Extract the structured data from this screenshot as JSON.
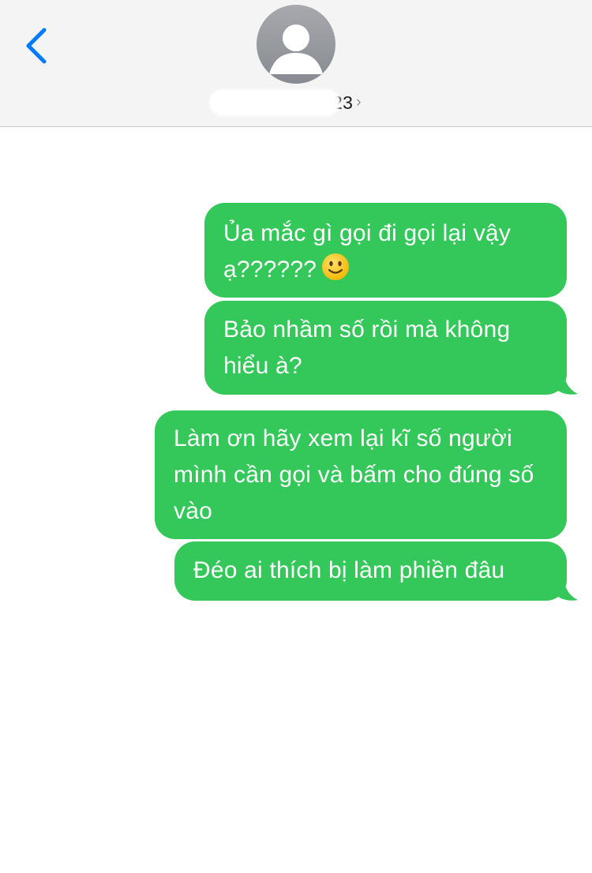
{
  "header": {
    "back_icon": "chevron-left-icon",
    "avatar_icon": "person-silhouette-icon",
    "contact_name": "23",
    "chevron": "›",
    "accent_color": "#007aff"
  },
  "messages": [
    {
      "text": "Ủa mắc gì gọi đi gọi lại vậy ạ??????",
      "emoji": "slightly-smiling-face"
    },
    {
      "text": "Bảo nhầm số rồi mà không hiểu à?"
    },
    {
      "text": "Làm ơn hãy xem lại kĩ số người mình cần gọi và bấm cho đúng số vào"
    },
    {
      "text": "Đéo ai thích bị làm phiền đâu"
    }
  ],
  "colors": {
    "bubble": "#34c759",
    "bubble_text": "#ffffff",
    "header_bg": "#f4f4f4"
  }
}
